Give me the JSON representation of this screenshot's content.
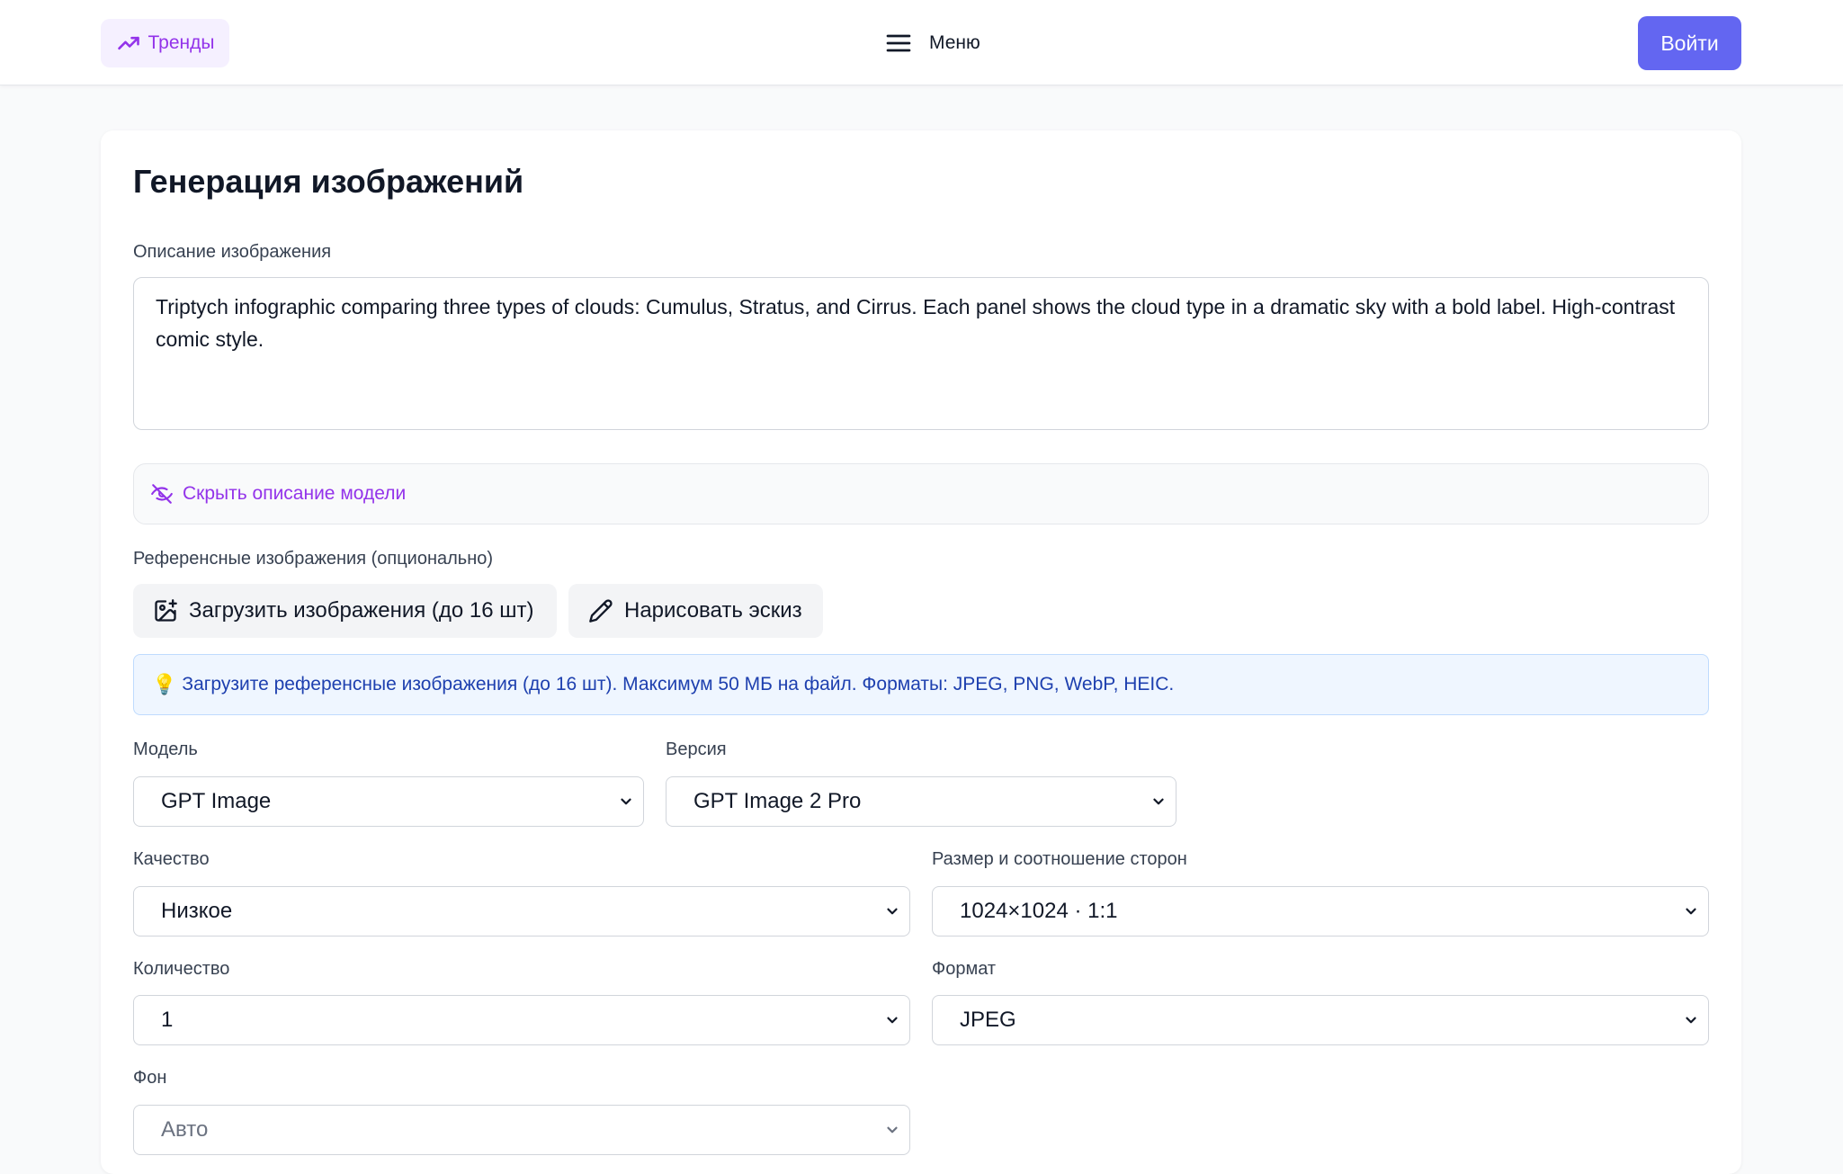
{
  "header": {
    "trends_label": "Тренды",
    "menu_label": "Меню",
    "login_label": "Войти"
  },
  "main": {
    "title": "Генерация изображений",
    "prompt_label": "Описание изображения",
    "prompt_value": "Triptych infographic comparing three types of clouds: Cumulus, Stratus, and Cirrus. Each panel shows the cloud type in a dramatic sky with a bold label. High-contrast comic style.",
    "hide_description_label": "Скрыть описание модели",
    "reference_label": "Референсные изображения (опционально)",
    "upload_button": "Загрузить изображения (до 16 шт)",
    "sketch_button": "Нарисовать эскиз",
    "info_text": "Загрузите референсные изображения (до 16 шт). Максимум 50 МБ на файл. Форматы: JPEG, PNG, WebP, HEIC."
  },
  "settings": {
    "model": {
      "label": "Модель",
      "value": "GPT Image"
    },
    "version": {
      "label": "Версия",
      "value": "GPT Image 2 Pro"
    },
    "quality": {
      "label": "Качество",
      "value": "Низкое"
    },
    "size": {
      "label": "Размер и соотношение сторон",
      "value": "1024×1024 · 1:1"
    },
    "count": {
      "label": "Количество",
      "value": "1"
    },
    "format": {
      "label": "Формат",
      "value": "JPEG"
    },
    "background": {
      "label": "Фон",
      "value": "Авто"
    }
  },
  "colors": {
    "accent": "#6366f1",
    "purple": "#9333ea",
    "info_text": "#1e40af",
    "info_bg": "#eff6ff"
  },
  "icons": {
    "trends": "trending-up-icon",
    "menu": "hamburger-icon",
    "hide": "eye-off-icon",
    "upload": "image-plus-icon",
    "sketch": "pencil-icon",
    "info": "lightbulb-icon",
    "select": "chevron-down-icon"
  }
}
